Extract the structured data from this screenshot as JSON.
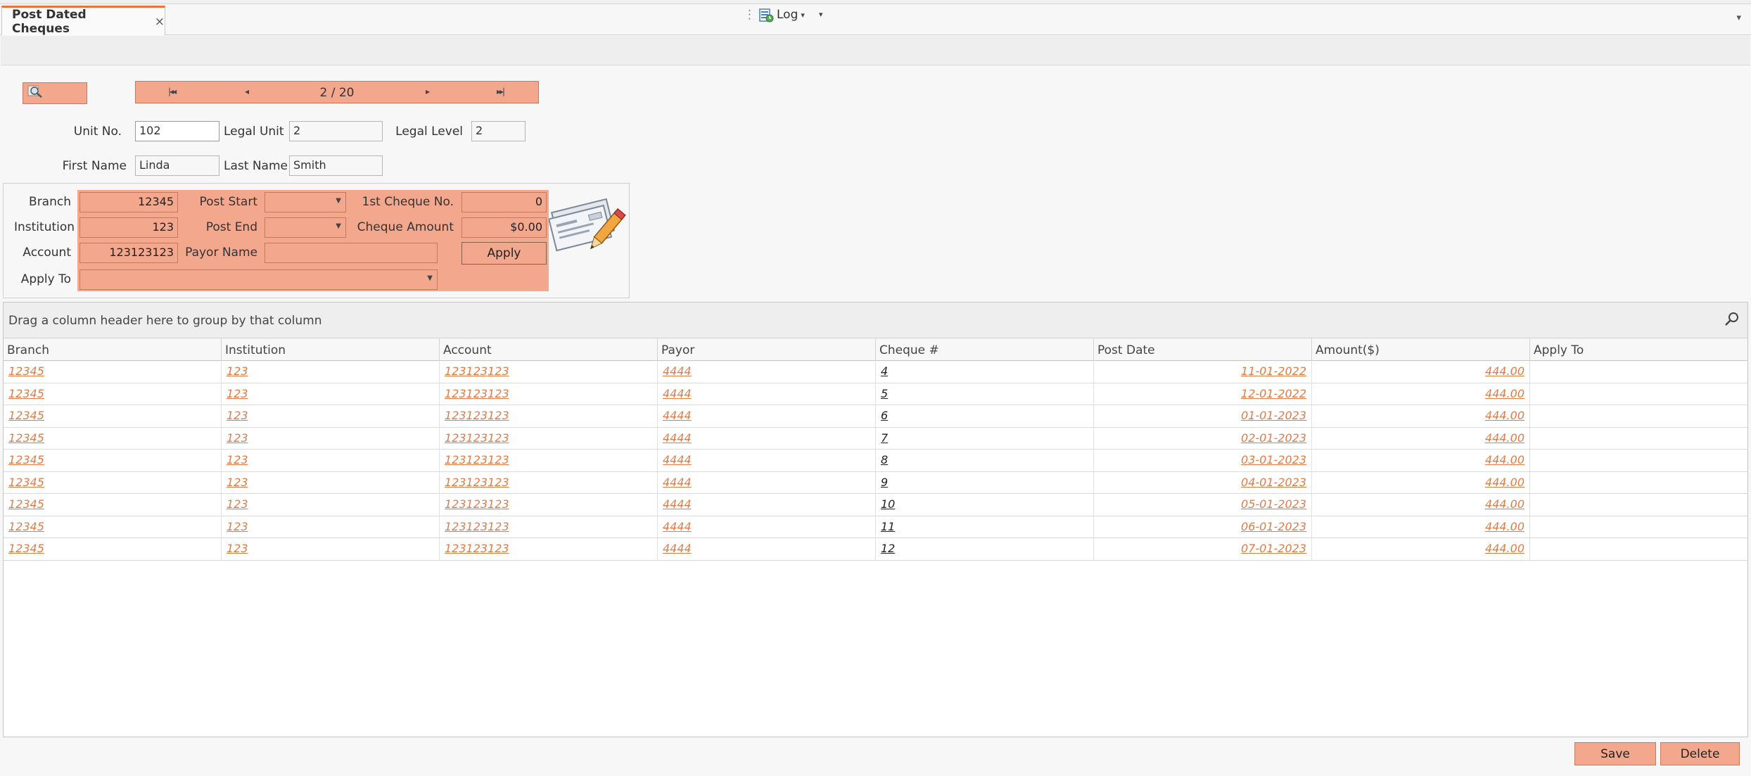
{
  "tab": {
    "title": "Post Dated Cheques",
    "close": "×",
    "menu_arrow": "▾"
  },
  "toolbar": {
    "log_label": "Log",
    "log_caret": "▾",
    "more_caret": "▾",
    "grip": "⋮"
  },
  "navigator": {
    "first": "|◂◂",
    "prev": "◂",
    "position": "2 / 20",
    "next": "▸",
    "last": "▸▸|"
  },
  "unit": {
    "unit_no_label": "Unit No.",
    "unit_no": "102",
    "legal_unit_label": "Legal Unit",
    "legal_unit": "2",
    "legal_level_label": "Legal Level",
    "legal_level": "2",
    "first_name_label": "First Name",
    "first_name": "Linda",
    "last_name_label": "Last Name",
    "last_name": "Smith"
  },
  "cheque_setup": {
    "branch_label": "Branch",
    "branch": "12345",
    "institution_label": "Institution",
    "institution": "123",
    "account_label": "Account",
    "account": "123123123",
    "apply_to_label": "Apply To",
    "apply_to": "",
    "post_start_label": "Post Start",
    "post_start": "",
    "post_end_label": "Post End",
    "post_end": "",
    "payor_name_label": "Payor Name",
    "payor_name": "",
    "first_cheque_label": "1st Cheque No.",
    "first_cheque": "0",
    "cheque_amount_label": "Cheque Amount",
    "cheque_amount": "$0.00",
    "apply_button": "Apply"
  },
  "grid": {
    "group_hint": "Drag a column header here to group by that column",
    "columns": [
      "Branch",
      "Institution",
      "Account",
      "Payor",
      "Cheque #",
      "Post Date",
      "Amount($)",
      "Apply To"
    ],
    "rows": [
      [
        "12345",
        "123",
        "123123123",
        "4444",
        "4",
        "11-01-2022",
        "444.00",
        ""
      ],
      [
        "12345",
        "123",
        "123123123",
        "4444",
        "5",
        "12-01-2022",
        "444.00",
        ""
      ],
      [
        "12345",
        "123",
        "123123123",
        "4444",
        "6",
        "01-01-2023",
        "444.00",
        ""
      ],
      [
        "12345",
        "123",
        "123123123",
        "4444",
        "7",
        "02-01-2023",
        "444.00",
        ""
      ],
      [
        "12345",
        "123",
        "123123123",
        "4444",
        "8",
        "03-01-2023",
        "444.00",
        ""
      ],
      [
        "12345",
        "123",
        "123123123",
        "4444",
        "9",
        "04-01-2023",
        "444.00",
        ""
      ],
      [
        "12345",
        "123",
        "123123123",
        "4444",
        "10",
        "05-01-2023",
        "444.00",
        ""
      ],
      [
        "12345",
        "123",
        "123123123",
        "4444",
        "11",
        "06-01-2023",
        "444.00",
        ""
      ],
      [
        "12345",
        "123",
        "123123123",
        "4444",
        "12",
        "07-01-2023",
        "444.00",
        ""
      ]
    ]
  },
  "actions": {
    "save": "Save",
    "delete": "Delete"
  },
  "colors": {
    "accent": "#f3a88d",
    "link": "#e07c46",
    "tab_border": "#e8743b"
  }
}
